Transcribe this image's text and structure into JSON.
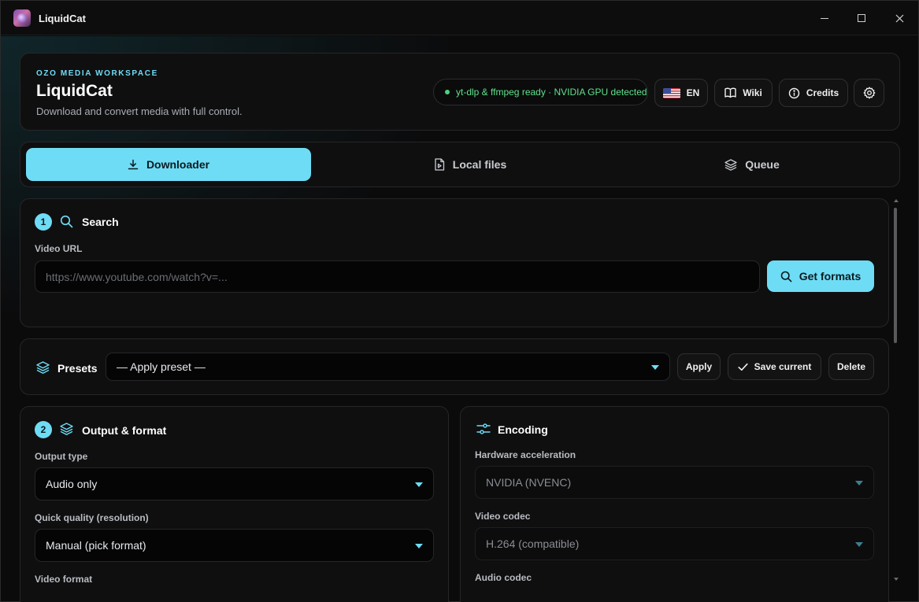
{
  "window": {
    "title": "LiquidCat",
    "icon": "liquidcat-app-icon"
  },
  "header": {
    "eyebrow": "OZO MEDIA WORKSPACE",
    "title": "LiquidCat",
    "subtitle": "Download and convert media with full control.",
    "status": "yt-dlp & ffmpeg ready · NVIDIA GPU detected",
    "status_color": "#5fe08a",
    "language": "EN",
    "wiki_label": "Wiki",
    "credits_label": "Credits"
  },
  "tabs": [
    {
      "label": "Downloader",
      "icon": "download-icon",
      "active": true
    },
    {
      "label": "Local files",
      "icon": "file-video-icon",
      "active": false
    },
    {
      "label": "Queue",
      "icon": "layers-icon",
      "active": false
    }
  ],
  "search": {
    "step": "1",
    "title": "Search",
    "url_label": "Video URL",
    "url_placeholder": "https://www.youtube.com/watch?v=...",
    "url_value": "",
    "get_formats_label": "Get formats"
  },
  "presets": {
    "title": "Presets",
    "selected": "— Apply preset —",
    "apply_label": "Apply",
    "save_label": "Save current",
    "delete_label": "Delete"
  },
  "output": {
    "step": "2",
    "title": "Output & format",
    "output_type_label": "Output type",
    "output_type_value": "Audio only",
    "quality_label": "Quick quality (resolution)",
    "quality_value": "Manual (pick format)",
    "video_format_label": "Video format"
  },
  "encoding": {
    "title": "Encoding",
    "hw_label": "Hardware acceleration",
    "hw_value": "NVIDIA (NVENC)",
    "video_codec_label": "Video codec",
    "video_codec_value": "H.264 (compatible)",
    "audio_codec_label": "Audio codec"
  },
  "colors": {
    "accent": "#6fdcf5",
    "background": "#0b0b0c",
    "card": "#0f0f10"
  }
}
